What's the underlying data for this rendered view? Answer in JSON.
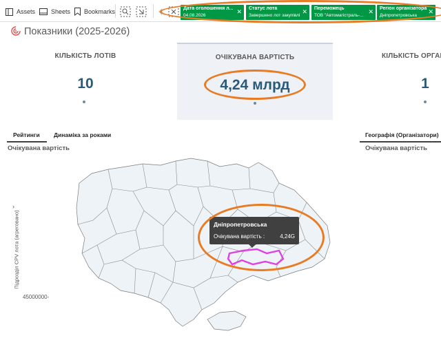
{
  "toolbar": {
    "assets_label": "Assets",
    "sheets_label": "Sheets",
    "bookmarks_label": "Bookmarks"
  },
  "selections": [
    {
      "title": "Дата оголошення л...",
      "value": "04.08.2026"
    },
    {
      "title": "Статус лота",
      "value": "Завершено лот закупівлі"
    },
    {
      "title": "Переможець",
      "value": "ТОВ \"Автомагістраль-..."
    },
    {
      "title": "Регіон організатора",
      "value": "Дніпропетровська"
    }
  ],
  "sheet": {
    "title": "Показники (2025-2026)"
  },
  "kpis": [
    {
      "title": "КІЛЬКІСТЬ ЛОТІВ",
      "value": "10"
    },
    {
      "title": "ОЧІКУВАНА ВАРТІСТЬ",
      "value": "4,24 млрд"
    },
    {
      "title": "КІЛЬКІСТЬ ОРГАНІ",
      "value": "1"
    }
  ],
  "tabs": {
    "ratings": "Рейтинги",
    "dynamics": "Динаміка за роками",
    "geography": "Географія (Організатори)"
  },
  "chart_subtitle_left": "Очікувана вартість",
  "chart_subtitle_right": "Очікувана вартість",
  "axis": {
    "ylabel": "Підрозділ CPV лота (агреговано)",
    "tick": "45000000-"
  },
  "tooltip": {
    "region": "Дніпропетровська",
    "label": "Очікувана вартість :",
    "value": "4,24G"
  },
  "colors": {
    "selection_green": "#009845",
    "kpi_value": "#2a5a7a",
    "highlight_region": "#e040e0",
    "annotation": "#e87b24"
  }
}
